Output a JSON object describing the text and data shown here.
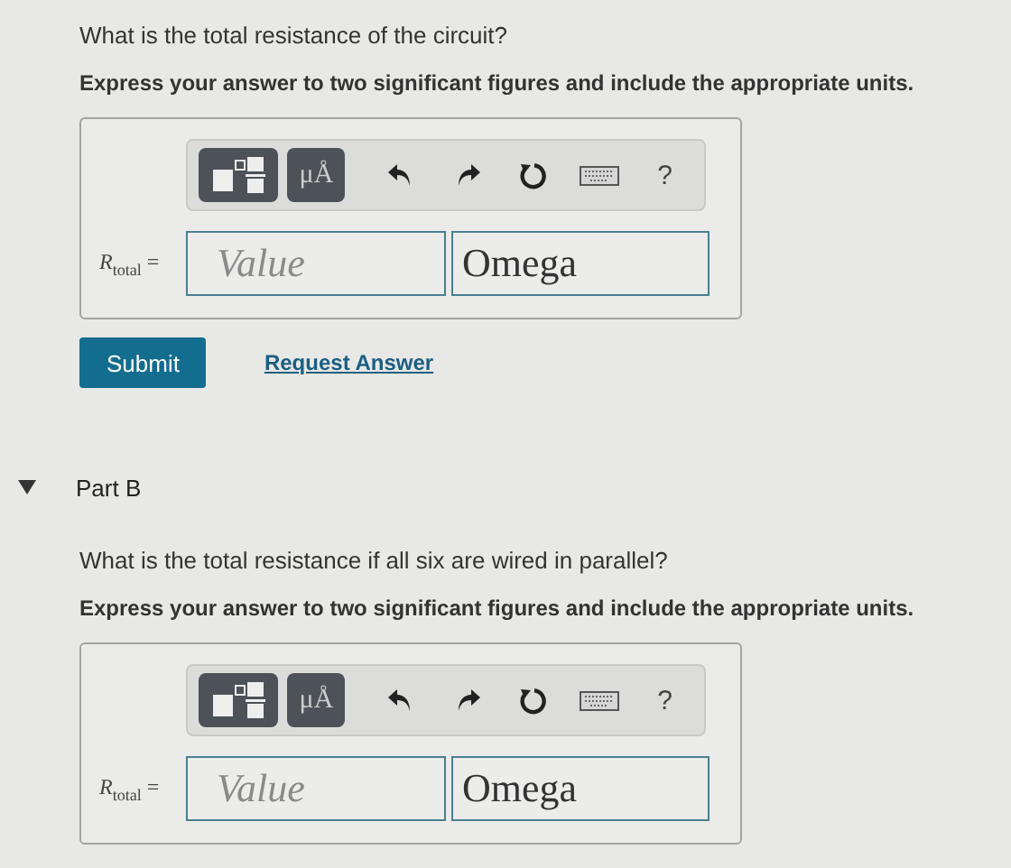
{
  "parts": [
    {
      "question": "What is the total resistance of the circuit?",
      "instruction": "Express your answer to two significant figures and include the appropriate units.",
      "toolbar": {
        "units_label": "μÅ",
        "help_label": "?"
      },
      "answer": {
        "variable": "R",
        "subscript": "total",
        "equals": "=",
        "value_placeholder": "Value",
        "unit_value": "Omega"
      },
      "actions": {
        "submit": "Submit",
        "request": "Request Answer"
      }
    },
    {
      "header": {
        "title": "Part B",
        "expanded": true
      },
      "question": "What is the total resistance if all six are wired in parallel?",
      "instruction": "Express your answer to two significant figures and include the appropriate units.",
      "toolbar": {
        "units_label": "μÅ",
        "help_label": "?"
      },
      "answer": {
        "variable": "R",
        "subscript": "total",
        "equals": "=",
        "value_placeholder": "Value",
        "unit_value": "Omega"
      }
    }
  ]
}
